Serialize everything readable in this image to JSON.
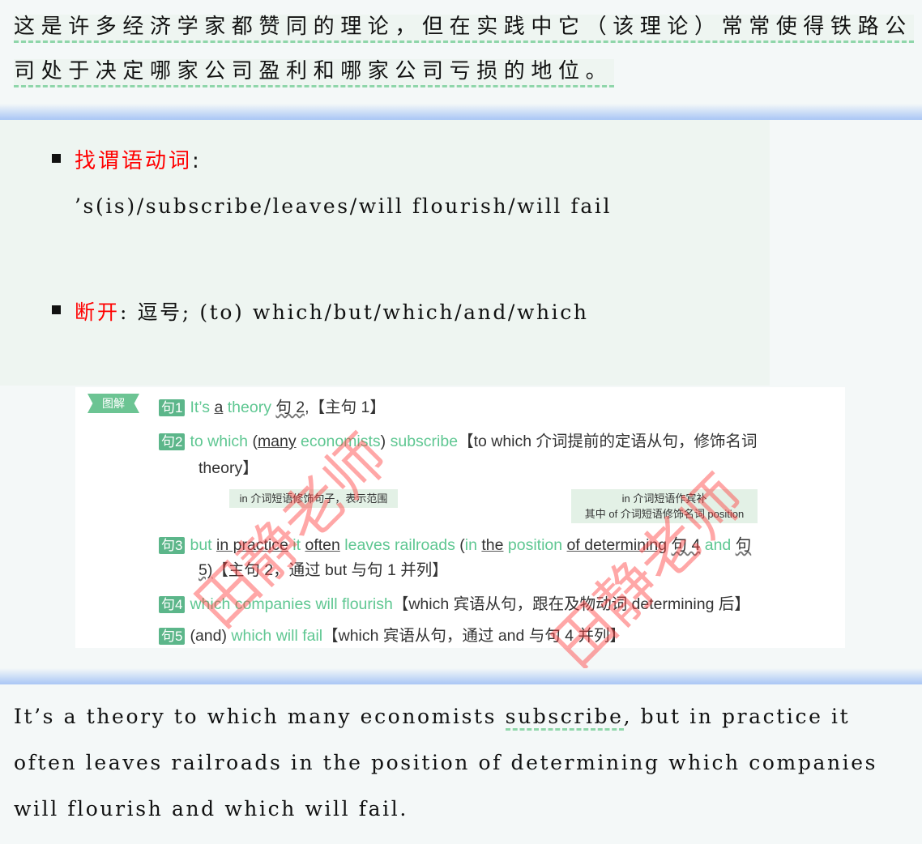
{
  "translation": {
    "line1": "这是许多经济学家都赞同的理论，但在实践中它（该理论）常常使得铁路公",
    "line2": "司处于决定哪家公司盈利和哪家公司亏损的地位。"
  },
  "analysis": {
    "predicate_label": "找谓语动词",
    "predicate_colon": ":",
    "predicates": "’s(is)/subscribe/leaves/will flourish/will fail",
    "break_label": "断开",
    "break_text": ": 逗号; (to) which/but/which/and/which"
  },
  "diagram": {
    "tag": "图解",
    "s1": {
      "badge": "句1",
      "a": "It’s",
      "b": "a",
      "c": "theory",
      "d": "句 2,",
      "e": "【主句 1】"
    },
    "s2": {
      "badge": "句2",
      "a": "to which",
      "b": "(",
      "c": "many",
      "d": "economists",
      "e": ")",
      "f": "subscribe",
      "g": "【to which 介词提前的定语从句，修饰名词",
      "h": "theory】"
    },
    "note1": "in 介词短语修饰句子，表示范围",
    "note2a": "in 介词短语作宾补",
    "note2b": "其中 of 介词短语修饰名词 position",
    "s3": {
      "badge": "句3",
      "a": "but",
      "b": "in practice",
      "c": "it",
      "d": "often",
      "e": "leaves railroads",
      "f": "(",
      "g": "in",
      "h": "the",
      "i": "position",
      "j": "of determining",
      "k": "句 4",
      "l": "and",
      "m": "句",
      "n": "5)",
      "o": "【主句 2，通过 but 与句 1 并列】"
    },
    "s4": {
      "badge": "句4",
      "a": "which companies will flourish",
      "b": "【which 宾语从句，跟在及物动词 determining 后】"
    },
    "s5": {
      "badge": "句5",
      "a": "(and)",
      "b": "which will fail",
      "c": "【which 宾语从句，通过 and 与句 4 并列】"
    },
    "watermark": "田静老师"
  },
  "sentence": {
    "l1a": "It’s a theory to which many economists ",
    "l1b": "subscribe",
    "l1c": ", but in practice it",
    "l2": "often leaves railroads in the position of determining which companies",
    "l3": "will flourish and which will fail."
  }
}
